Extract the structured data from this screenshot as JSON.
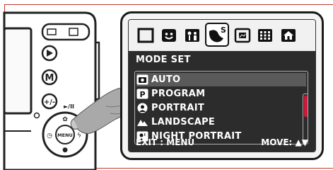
{
  "camera": {
    "icons": [
      "wide-angle-icon",
      "telephoto-icon",
      "playback-icon",
      "menu-icon",
      "exposure-compensation-icon",
      "self-timer-icon",
      "macro-icon",
      "flash-icon",
      "focus-icon"
    ],
    "playback_label": "▶",
    "menu_label": "M",
    "exposure_label": "+/-",
    "play_pause_label": "►/II",
    "center_button_label": "MENU"
  },
  "mode_bar": {
    "icons": [
      "full-screen-icon",
      "smile-icon",
      "flower-person-icon",
      "scene-selected-icon",
      "frame-icon",
      "grid-icon",
      "house-icon"
    ],
    "selected_index": 3
  },
  "menu": {
    "title": "MODE SET",
    "items": [
      {
        "label": "AUTO",
        "icon": "camera-icon",
        "selected": true
      },
      {
        "label": "PROGRAM",
        "icon": "program-icon",
        "selected": false
      },
      {
        "label": "PORTRAIT",
        "icon": "portrait-icon",
        "selected": false
      },
      {
        "label": "LANDSCAPE",
        "icon": "mountain-icon",
        "selected": false
      },
      {
        "label": "NIGHT PORTRAIT",
        "icon": "night-portrait-icon",
        "selected": false
      }
    ],
    "footer_left": "EXIT : MENU",
    "footer_right": "MOVE: ▲▼"
  },
  "colors": {
    "panel": "#2c2c2c",
    "selected_row": "#5a5a5a",
    "scroll_thumb": "#d0183b",
    "border": "#c0392b"
  }
}
